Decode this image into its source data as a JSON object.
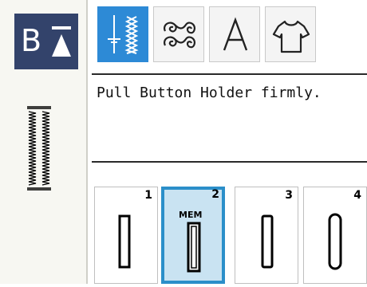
{
  "sidebar": {
    "mode_label": "B",
    "mode_icon": "up-triangle-icon",
    "pattern_preview_icon": "buttonhole-stitch-preview-icon"
  },
  "tabs": [
    {
      "name": "utility-stitch",
      "icon": "utility-stitch-icon",
      "active": true
    },
    {
      "name": "decorative-stitch",
      "icon": "decorative-scroll-icon",
      "active": false
    },
    {
      "name": "letters",
      "label": "A",
      "icon": "letter-a-icon",
      "active": false
    },
    {
      "name": "garment",
      "icon": "shirt-icon",
      "active": false
    }
  ],
  "message": "Pull Button Holder firmly.",
  "buttonholes": [
    {
      "number": "1",
      "mem": "",
      "selected": false,
      "icon": "square-buttonhole-icon"
    },
    {
      "number": "2",
      "mem": "MEM",
      "selected": true,
      "icon": "standard-buttonhole-icon"
    },
    {
      "number": "3",
      "mem": "",
      "selected": false,
      "icon": "rounded-buttonhole-icon"
    },
    {
      "number": "4",
      "mem": "",
      "selected": false,
      "icon": "oval-buttonhole-icon"
    }
  ],
  "colors": {
    "active_tab": "#2d8ad6",
    "selected_card_bg": "#c9e3f2",
    "selected_card_border": "#2b8fc9",
    "mode_box": "#33436b"
  }
}
